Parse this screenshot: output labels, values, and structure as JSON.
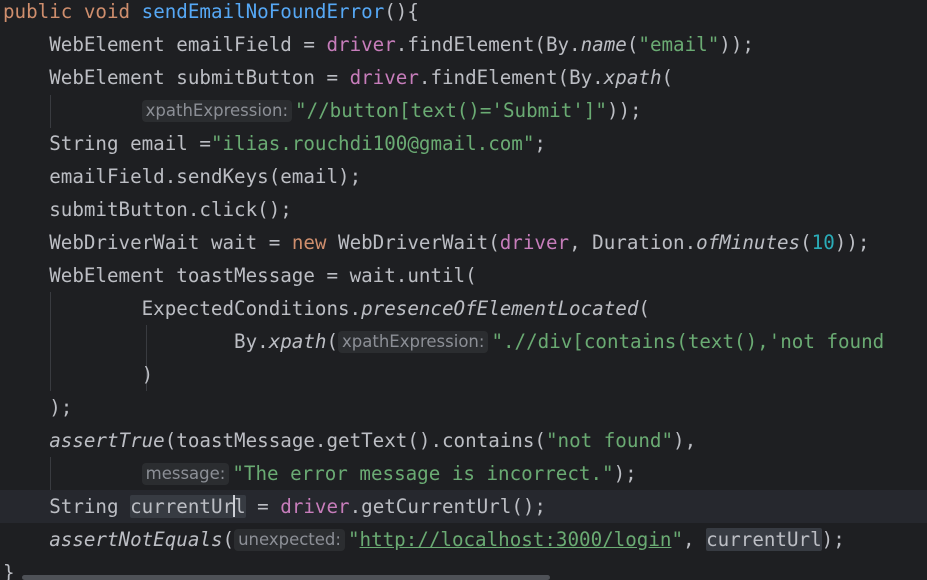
{
  "editor": {
    "lines": [
      {
        "a": "public",
        "b": "void",
        "c": "sendEmailNoFoundError",
        "d": "(){"
      },
      {
        "a": "WebElement emailField = ",
        "b": "driver",
        "c": ".findElement(By.",
        "d": "name",
        "e": "(",
        "f": "\"email\"",
        "g": "));"
      },
      {
        "a": "WebElement submitButton = ",
        "b": "driver",
        "c": ".findElement(By.",
        "d": "xpath",
        "e": "("
      },
      {
        "hint": "xpathExpression:",
        "a": "\"//button[text()='Submit']\"",
        "b": "));"
      },
      {
        "a": "String email =",
        "b": "\"ilias.rouchdi100@gmail.com\"",
        "c": ";"
      },
      {
        "a": "emailField.sendKeys(email);"
      },
      {
        "a": "submitButton.click();"
      },
      {
        "a": "WebDriverWait wait = ",
        "b": "new",
        "c": " WebDriverWait(",
        "d": "driver",
        "e": ", Duration.",
        "f": "ofMinutes",
        "g": "(",
        "h": "10",
        "i": "));"
      },
      {
        "a": "WebElement toastMessage = wait.until("
      },
      {
        "a": "ExpectedConditions.",
        "b": "presenceOfElementLocated",
        "c": "("
      },
      {
        "a": "By.",
        "b": "xpath",
        "c": "(",
        "hint": "xpathExpression:",
        "d": "\".//div[contains(text(),'not found"
      },
      {
        "a": ")"
      },
      {
        "a": ");"
      },
      {
        "a": "assertTrue",
        "b": "(toastMessage.getText().contains(",
        "c": "\"not found\"",
        "d": "),"
      },
      {
        "hint": "message:",
        "a": "\"The error message is incorrect.\"",
        "b": ");"
      },
      {
        "a": "String ",
        "b1": "currentUr",
        "b2": "l",
        "c": " = ",
        "d": "driver",
        "e": ".getCurrentUrl();"
      },
      {
        "a": "assertNotEquals",
        "b": "(",
        "hint": "unexpected:",
        "c1": "\"",
        "c2": "http://localhost:3000/login",
        "c3": "\"",
        "d": ", ",
        "e": "currentUrl",
        "f": ");"
      },
      {
        "a": "}"
      }
    ]
  }
}
